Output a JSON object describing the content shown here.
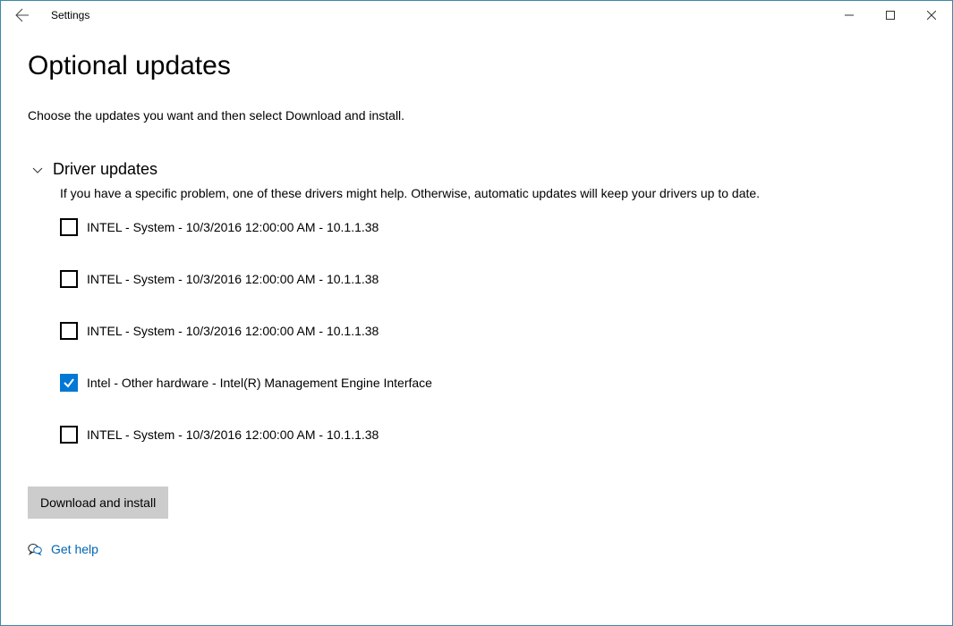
{
  "window": {
    "app_title": "Settings"
  },
  "page": {
    "title": "Optional updates",
    "description": "Choose the updates you want and then select Download and install."
  },
  "section": {
    "title": "Driver updates",
    "description": "If you have a specific problem, one of these drivers might help. Otherwise, automatic updates will keep your drivers up to date."
  },
  "updates": [
    {
      "label": "INTEL - System - 10/3/2016 12:00:00 AM - 10.1.1.38",
      "checked": false
    },
    {
      "label": "INTEL - System - 10/3/2016 12:00:00 AM - 10.1.1.38",
      "checked": false
    },
    {
      "label": "INTEL - System - 10/3/2016 12:00:00 AM - 10.1.1.38",
      "checked": false
    },
    {
      "label": "Intel - Other hardware - Intel(R) Management Engine Interface",
      "checked": true
    },
    {
      "label": "INTEL - System - 10/3/2016 12:00:00 AM - 10.1.1.38",
      "checked": false
    }
  ],
  "actions": {
    "download_install": "Download and install",
    "get_help": "Get help"
  }
}
